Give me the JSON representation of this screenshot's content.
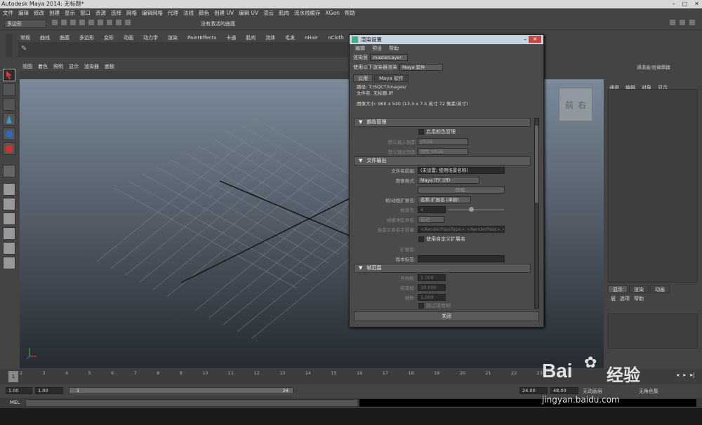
{
  "window": {
    "title": "Autodesk Maya 2014: 无标题*"
  },
  "menubar": [
    "文件",
    "编辑",
    "修改",
    "创建",
    "显示",
    "窗口",
    "资源",
    "选择",
    "网格",
    "编辑网格",
    "代理",
    "法线",
    "颜色",
    "创建 UV",
    "编辑 UV",
    "渲云",
    "肌肉",
    "流水线缓存",
    "XGen",
    "帮助"
  ],
  "status": {
    "mode": "多边形",
    "live_field": "没有激活的曲面"
  },
  "shelf_tabs": [
    "常规",
    "曲线",
    "曲面",
    "多边形",
    "变形",
    "动画",
    "动力学",
    "渲染",
    "PaintEffects",
    "卡通",
    "肌肉",
    "流体",
    "毛发",
    "nHair",
    "nCloth"
  ],
  "viewport_menu": [
    "视图",
    "着色",
    "照明",
    "显示",
    "渲染器",
    "面板"
  ],
  "viewcube_labels": [
    "前",
    "右"
  ],
  "right_panel": {
    "header": "通道盒/层编辑器",
    "menus": [
      "通道",
      "编辑",
      "对象",
      "显示"
    ],
    "tabs": [
      "显示",
      "渲染",
      "动画"
    ],
    "submenus": [
      "层",
      "选项",
      "帮助"
    ]
  },
  "timeline": {
    "ticks": [
      "1",
      "2",
      "3",
      "4",
      "5",
      "6",
      "7",
      "8",
      "9",
      "10",
      "11",
      "12",
      "13",
      "14",
      "15",
      "16",
      "17",
      "18",
      "19",
      "20",
      "21",
      "22",
      "23"
    ],
    "current": "1"
  },
  "range": {
    "start": "1.00",
    "inner_start": "1.00",
    "inner_start_marker": "1",
    "inner_end_marker": "24",
    "inner_end": "24.00",
    "end": "48.00",
    "anim_layer": "无动画层",
    "char_set": "无角色集"
  },
  "cmdline": {
    "label": "MEL"
  },
  "dialog": {
    "title": "渲染设置",
    "menus": [
      "编辑",
      "预设",
      "帮助"
    ],
    "render_layer_label": "渲染层",
    "render_layer_value": "masterLayer",
    "renderer_label": "使用以下渲染器渲染",
    "renderer_value": "Maya 软件",
    "tabs": [
      "公用",
      "Maya 软件"
    ],
    "path_line": "路径: T:/SQCT/images/",
    "filename_line": "文件名: 无标题.iff",
    "image_size_line": "图像大小: 960 x 540 (13.3 x 7.5 英寸 72 像素/英寸)",
    "section_color": "颜色管理",
    "enable_color_mgmt": "启用颜色管理",
    "default_input_profile_label": "默认输入剖面",
    "default_input_profile_value": "sRGB",
    "default_output_profile_label": "默认输出剖面",
    "default_output_profile_value": "线性 sRGB",
    "section_file": "文件输出",
    "prefix_label": "文件名前缀:",
    "prefix_value": "(未设置; 使用场景名称)",
    "format_label": "图像格式:",
    "format_value": "Maya IFF (iff)",
    "compress_button": "压缩...",
    "frame_ext_label": "帧/动画扩展名:",
    "frame_ext_value": "名称.扩展名 (单帧)",
    "padding_label": "帧填充:",
    "padding_value": "4",
    "buffer_label": "帧缓冲区命名:",
    "buffer_value": "自动",
    "custom_token_label": "自定义命名字符串:",
    "custom_token_value": "<RenderPassType>:<RenderPass>.<Camera>",
    "use_custom_ext": "使用自定义扩展名",
    "ext_label": "扩展名:",
    "version_label": "版本标签:",
    "section_range": "帧范围",
    "start_label": "开始帧:",
    "start_value": "1.000",
    "end_label": "结束帧:",
    "end_value": "10.000",
    "step_label": "帧数:",
    "step_value": "1.000",
    "skip_label": "跳过现有帧",
    "close_button": "关闭"
  },
  "watermark": {
    "brand": "Bai",
    "brand2": "经验",
    "url": "jingyan.baidu.com"
  }
}
